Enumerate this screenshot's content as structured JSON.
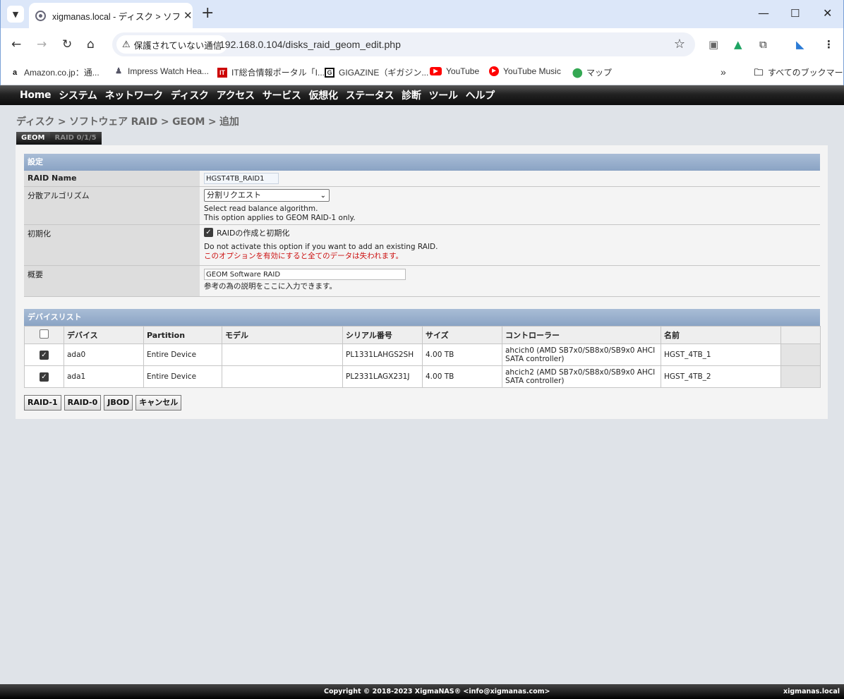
{
  "browser": {
    "tab_title": "xigmanas.local - ディスク > ソフトウ",
    "tab_close": "✕",
    "new_tab": "+",
    "security_label": "保護されていない通信",
    "url": "192.168.0.104/disks_raid_geom_edit.php",
    "bookmarks": [
      {
        "label": "Amazon.co.jp：通...",
        "icon": "amazon-icon"
      },
      {
        "label": "Impress Watch Hea...",
        "icon": "impress-icon"
      },
      {
        "label": "IT総合情報ポータル「I...",
        "icon": "itmedia-icon"
      },
      {
        "label": "GIGAZINE（ギガジン...",
        "icon": "gigazine-icon"
      },
      {
        "label": "YouTube",
        "icon": "youtube-icon"
      },
      {
        "label": "YouTube Music",
        "icon": "youtube-music-icon"
      },
      {
        "label": "マップ",
        "icon": "maps-icon"
      }
    ],
    "all_bookmarks": "すべてのブックマーク"
  },
  "nav": {
    "items": [
      "Home",
      "システム",
      "ネットワーク",
      "ディスク",
      "アクセス",
      "サービス",
      "仮想化",
      "ステータス",
      "診断",
      "ツール",
      "ヘルプ"
    ]
  },
  "breadcrumb": "ディスク > ソフトウェア RAID > GEOM > 追加",
  "subtabs": [
    "GEOM",
    "RAID 0/1/5"
  ],
  "settings": {
    "header": "設定",
    "raid_name_label": "RAID Name",
    "raid_name_value": "HGST4TB_RAID1",
    "balance_label": "分散アルゴリズム",
    "balance_value": "分割リクエスト",
    "balance_desc1": "Select read balance algorithm.",
    "balance_desc2": "This option applies to GEOM RAID-1 only.",
    "init_label": "初期化",
    "init_checkbox_label": "RAIDの作成と初期化",
    "init_desc": "Do not activate this option if you want to add an existing RAID.",
    "init_warning": "このオプションを有効にすると全てのデータは失われます。",
    "summary_label": "概要",
    "summary_value": "GEOM Software RAID",
    "summary_desc": "参考の為の説明をここに入力できます。"
  },
  "devices": {
    "header": "デバイスリスト",
    "columns": [
      "デバイス",
      "Partition",
      "モデル",
      "シリアル番号",
      "サイズ",
      "コントローラー",
      "名前"
    ],
    "rows": [
      {
        "device": "ada0",
        "partition": "Entire Device",
        "model": "",
        "serial": "PL1331LAHGS2SH",
        "size": "4.00 TB",
        "controller": "ahcich0 (AMD SB7x0/SB8x0/SB9x0 AHCI SATA controller)",
        "name": "HGST_4TB_1"
      },
      {
        "device": "ada1",
        "partition": "Entire Device",
        "model": "",
        "serial": "PL2331LAGX231J",
        "size": "4.00 TB",
        "controller": "ahcich2 (AMD SB7x0/SB8x0/SB9x0 AHCI SATA controller)",
        "name": "HGST_4TB_2"
      }
    ]
  },
  "buttons": {
    "raid1": "RAID-1",
    "raid0": "RAID-0",
    "jbod": "JBOD",
    "cancel": "キャンセル"
  },
  "footer": {
    "copyright": "Copyright © 2018-2023 XigmaNAS® <info@xigmanas.com>",
    "hostname": "xigmanas.local"
  }
}
